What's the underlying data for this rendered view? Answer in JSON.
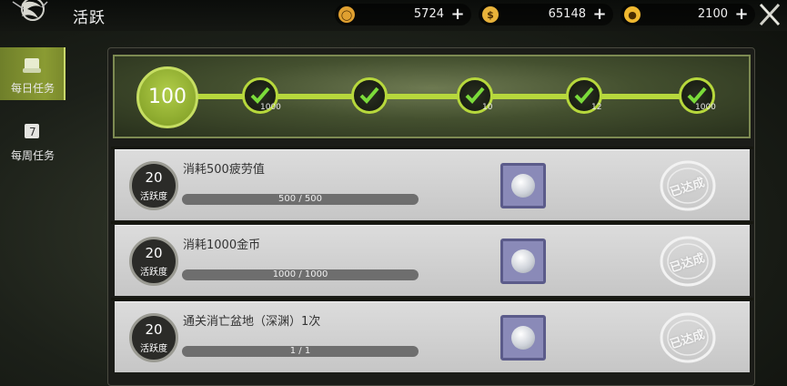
{
  "header": {
    "title": "活跃",
    "currencies": [
      {
        "icon": "coin-ring-icon",
        "amount": "5724",
        "color": "#e0a030"
      },
      {
        "icon": "money-bag-icon",
        "amount": "65148",
        "color": "#e8b23a"
      },
      {
        "icon": "gold-coin-icon",
        "amount": "2100",
        "color": "#f0b830"
      }
    ]
  },
  "sidebar": {
    "tabs": [
      {
        "label": "每日任务",
        "active": true
      },
      {
        "label": "每周任务",
        "active": false,
        "icon_digit": "7"
      }
    ]
  },
  "progress": {
    "current": "100",
    "rewards": [
      {
        "qty": "1000"
      },
      {
        "qty": ""
      },
      {
        "qty": "10"
      },
      {
        "qty": "12"
      },
      {
        "qty": "1000"
      }
    ],
    "accent": "#b7d83c"
  },
  "tasks": [
    {
      "points": "20",
      "unit": "活跃度",
      "title": "消耗500疲劳值",
      "progress_text": "500 / 500",
      "progress": 1.0,
      "status": "已达成"
    },
    {
      "points": "20",
      "unit": "活跃度",
      "title": "消耗1000金币",
      "progress_text": "1000 / 1000",
      "progress": 1.0,
      "status": "已达成"
    },
    {
      "points": "20",
      "unit": "活跃度",
      "title": "通关消亡盆地（深渊）1次",
      "progress_text": "1 / 1",
      "progress": 1.0,
      "status": "已达成"
    }
  ]
}
